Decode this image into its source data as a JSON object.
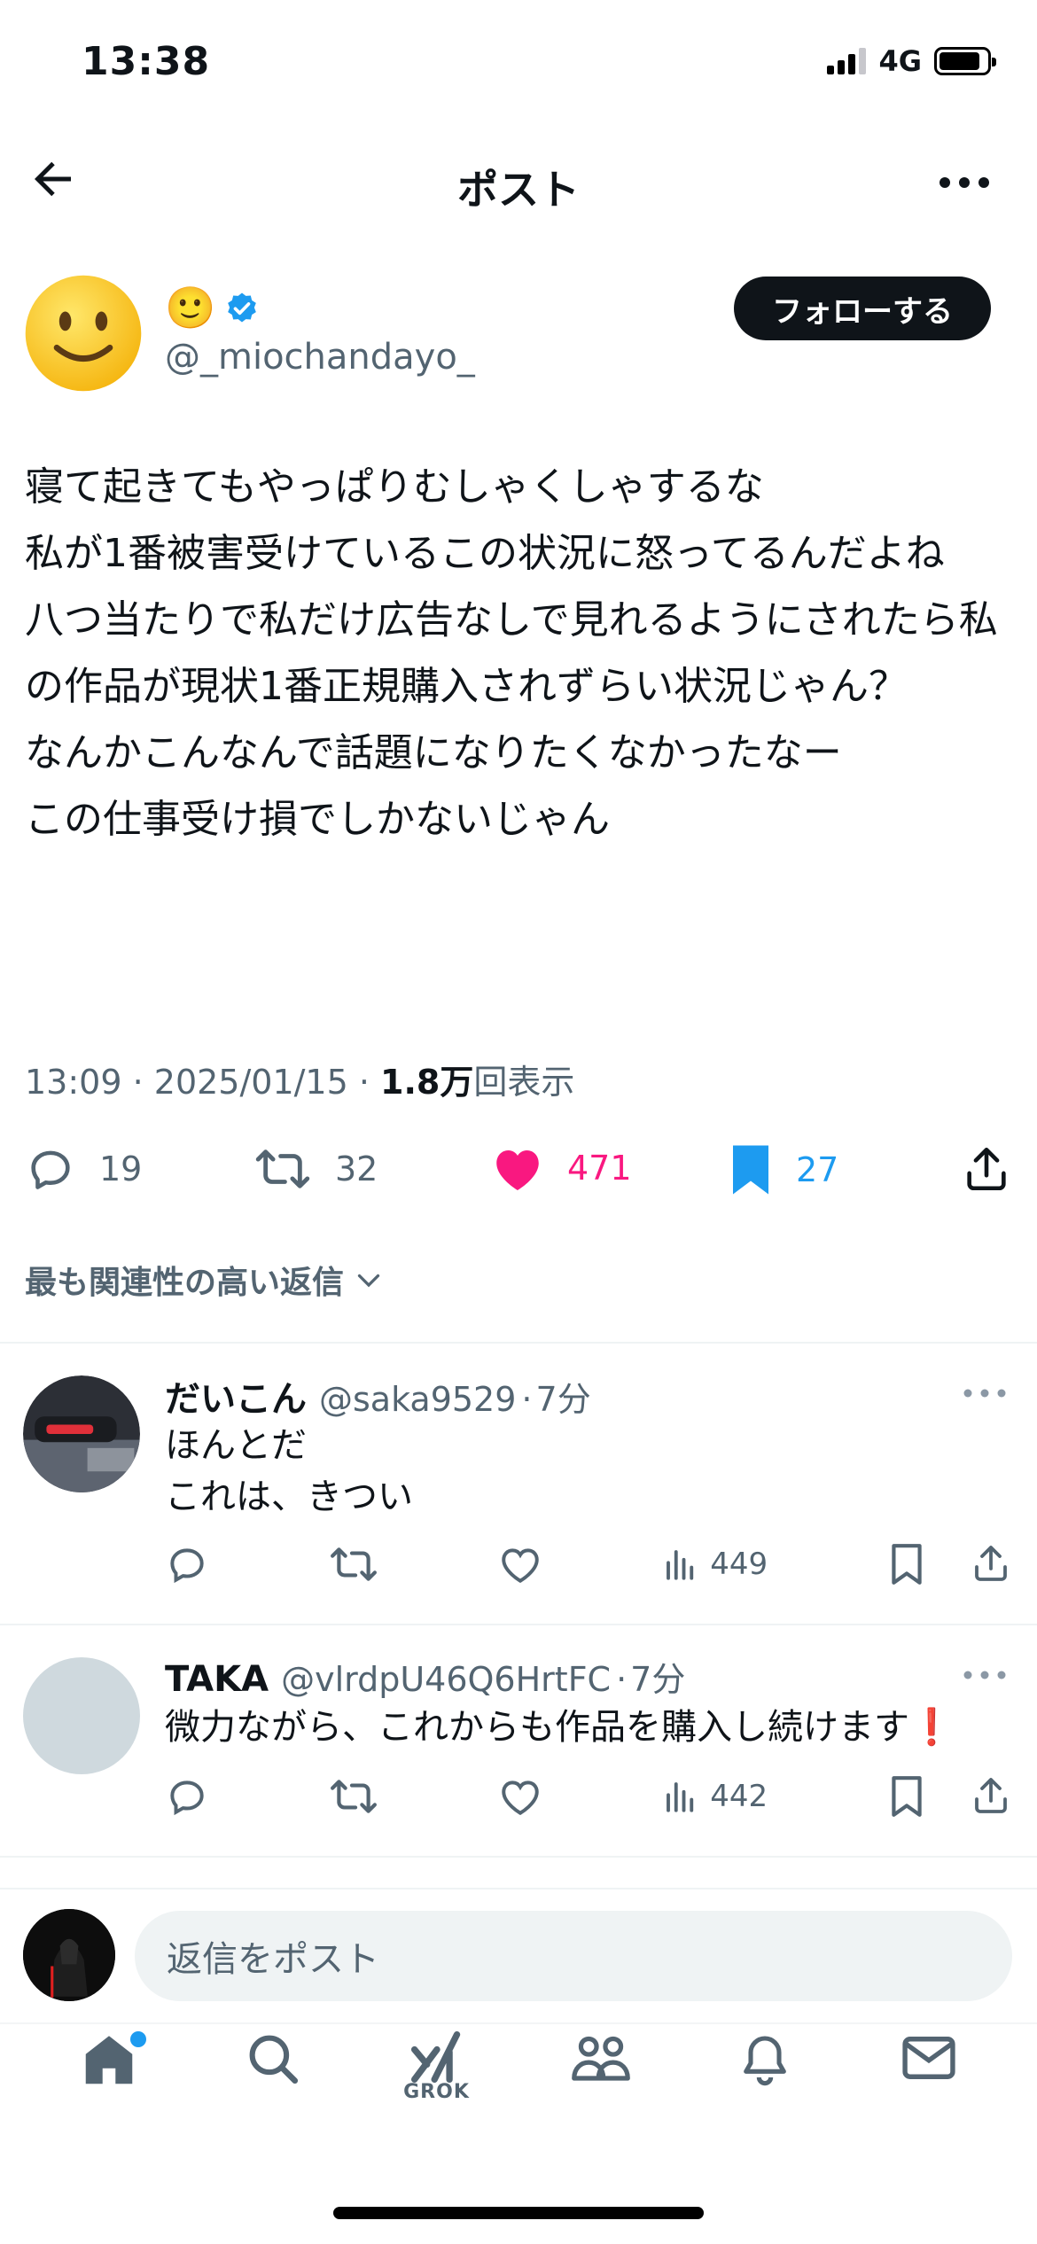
{
  "status_bar": {
    "time": "13:38",
    "network": "4G"
  },
  "header": {
    "title": "ポスト"
  },
  "author": {
    "display_name": "🙂",
    "handle": "@_miochandayo_",
    "follow_label": "フォローする"
  },
  "post": {
    "text": "寝て起きてもやっぱりむしゃくしゃするな\n私が1番被害受けているこの状況に怒ってるんだよね\n八つ当たりで私だけ広告なしで見れるようにされたら私の作品が現状1番正規購入されずらい状況じゃん？\nなんかこんなんで話題になりたくなかったなー\nこの仕事受け損でしかないじゃん",
    "time": "13:09",
    "date": "2025/01/15",
    "views": "1.8万",
    "views_suffix": "回表示",
    "replies": "19",
    "reposts": "32",
    "likes": "471",
    "bookmarks": "27"
  },
  "sort": {
    "label": "最も関連性の高い返信"
  },
  "replies": [
    {
      "name": "だいこん",
      "handle": "@saka9529",
      "time": "7分",
      "text": "ほんとだ\nこれは、きつい",
      "views": "449"
    },
    {
      "name": "TAKA",
      "handle": "@vlrdpU46Q6HrtFC",
      "time": "7分",
      "text": "微力ながら、これからも作品を購入し続けます❗️",
      "views": "442"
    }
  ],
  "compose": {
    "placeholder": "返信をポスト"
  },
  "tabs": [
    {
      "icon": "home-icon"
    },
    {
      "icon": "search-icon"
    },
    {
      "icon": "grok-icon",
      "label": "GROK"
    },
    {
      "icon": "communities-icon"
    },
    {
      "icon": "notifications-icon"
    },
    {
      "icon": "messages-icon"
    }
  ],
  "colors": {
    "accent": "#1d9bf0",
    "like": "#f91880",
    "muted": "#536471",
    "text": "#0f1419"
  }
}
